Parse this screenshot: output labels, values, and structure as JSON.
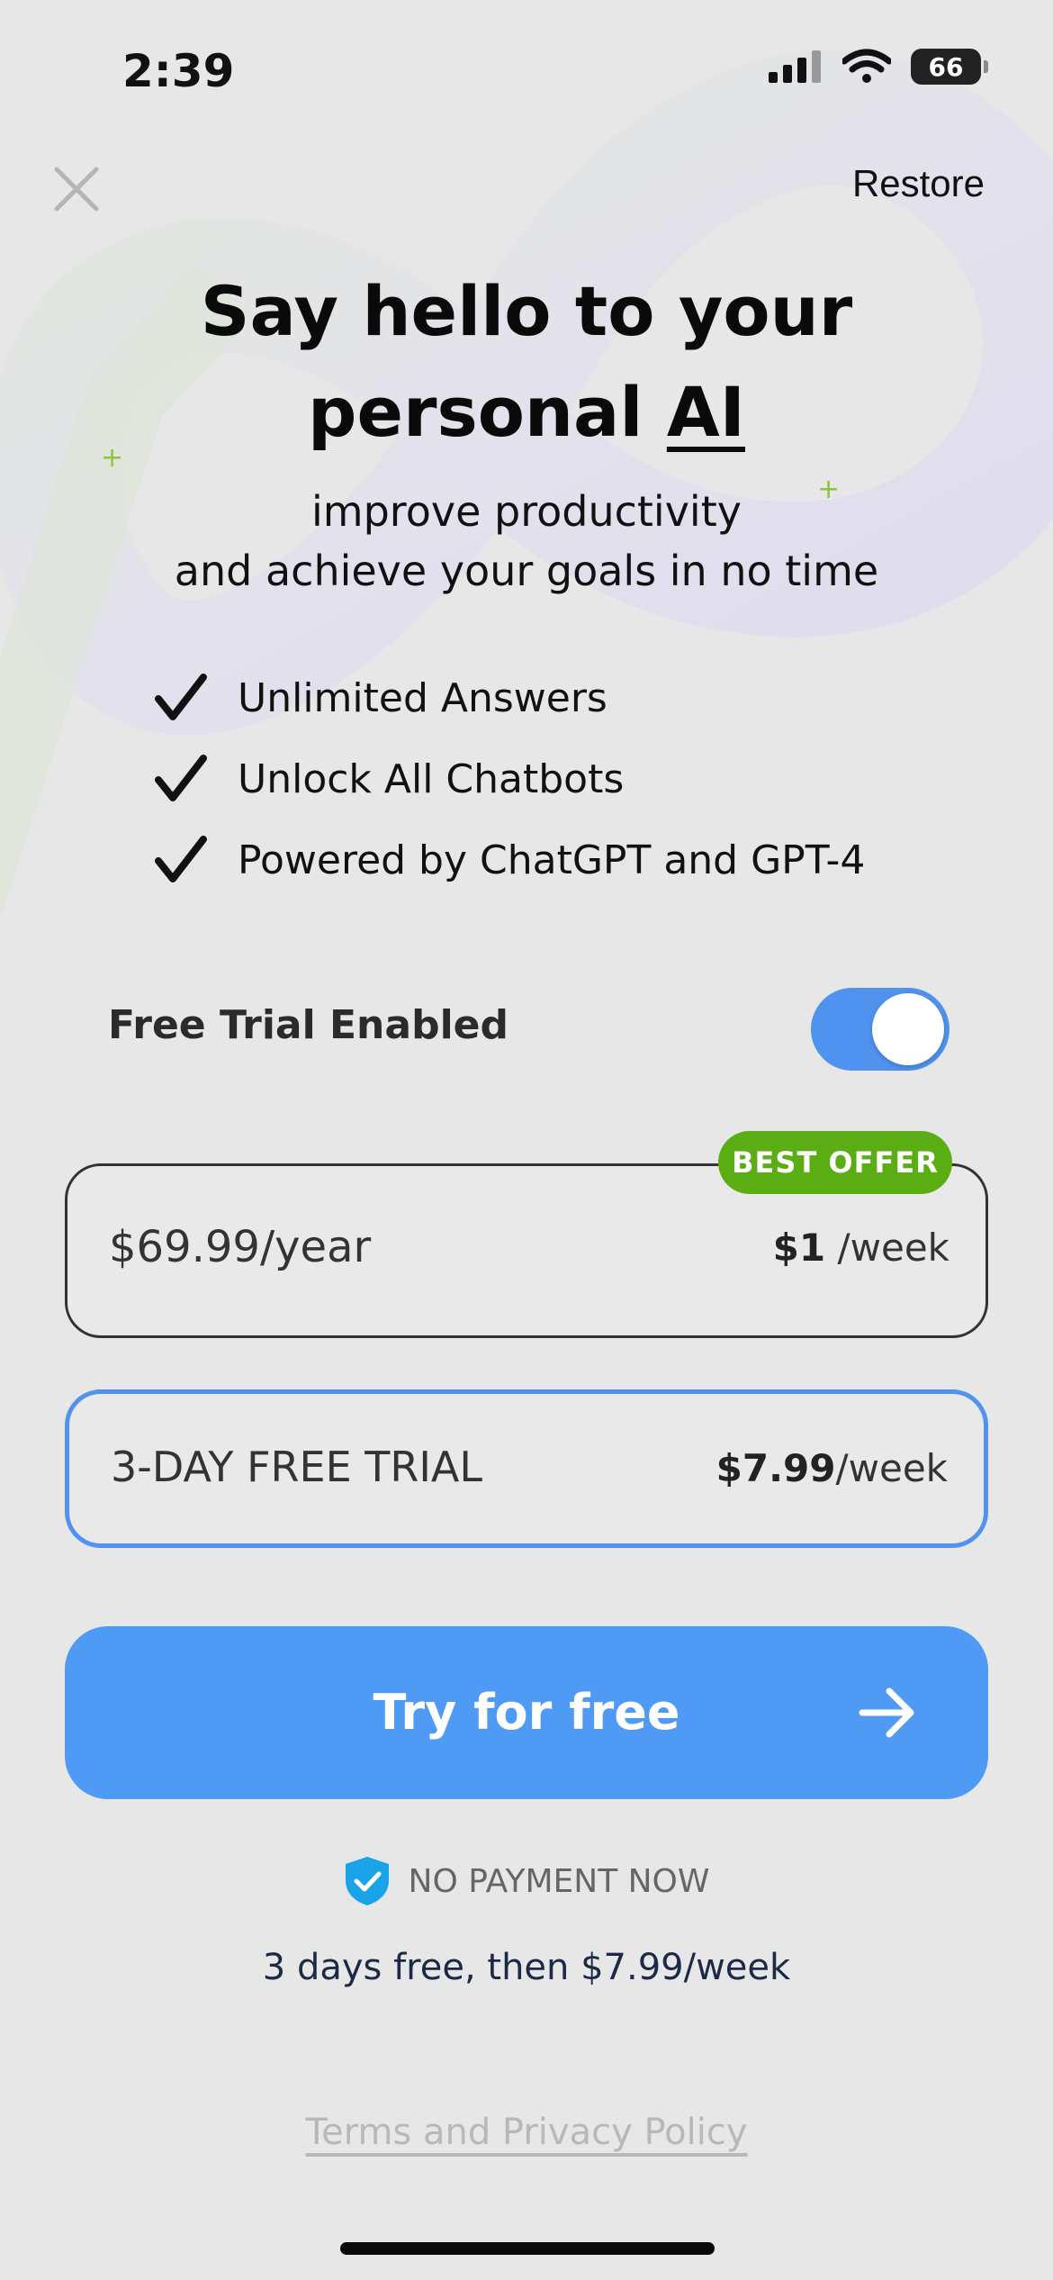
{
  "status_bar": {
    "time": "2:39",
    "battery": "66"
  },
  "header": {
    "restore_label": "Restore"
  },
  "hero": {
    "title_line1": "Say hello to your",
    "title_line2_prefix": "personal",
    "title_line2_highlight": "AI",
    "subtitle_line1": "improve productivity",
    "subtitle_line2": "and achieve your goals in no time"
  },
  "features": [
    "Unlimited Answers",
    "Unlock All Chatbots",
    "Powered by ChatGPT and GPT-4"
  ],
  "trial_toggle": {
    "label": "Free Trial Enabled",
    "enabled": true
  },
  "plans": {
    "badge": "BEST OFFER",
    "yearly": {
      "price": "$69.99/year",
      "per_week_amount": "$1",
      "per_week_unit": "/week"
    },
    "weekly": {
      "label": "3-DAY FREE TRIAL",
      "per_week_amount": "$7.99",
      "per_week_unit": "/week",
      "selected": true
    }
  },
  "cta": {
    "label": "Try for free"
  },
  "assurance": {
    "no_payment": "NO PAYMENT NOW",
    "price_note": "3 days free, then $7.99/week"
  },
  "footer": {
    "terms": "Terms and Privacy Policy"
  },
  "colors": {
    "accent": "#4f9af5",
    "badge": "#5aad12",
    "background": "#e7e7e7"
  }
}
